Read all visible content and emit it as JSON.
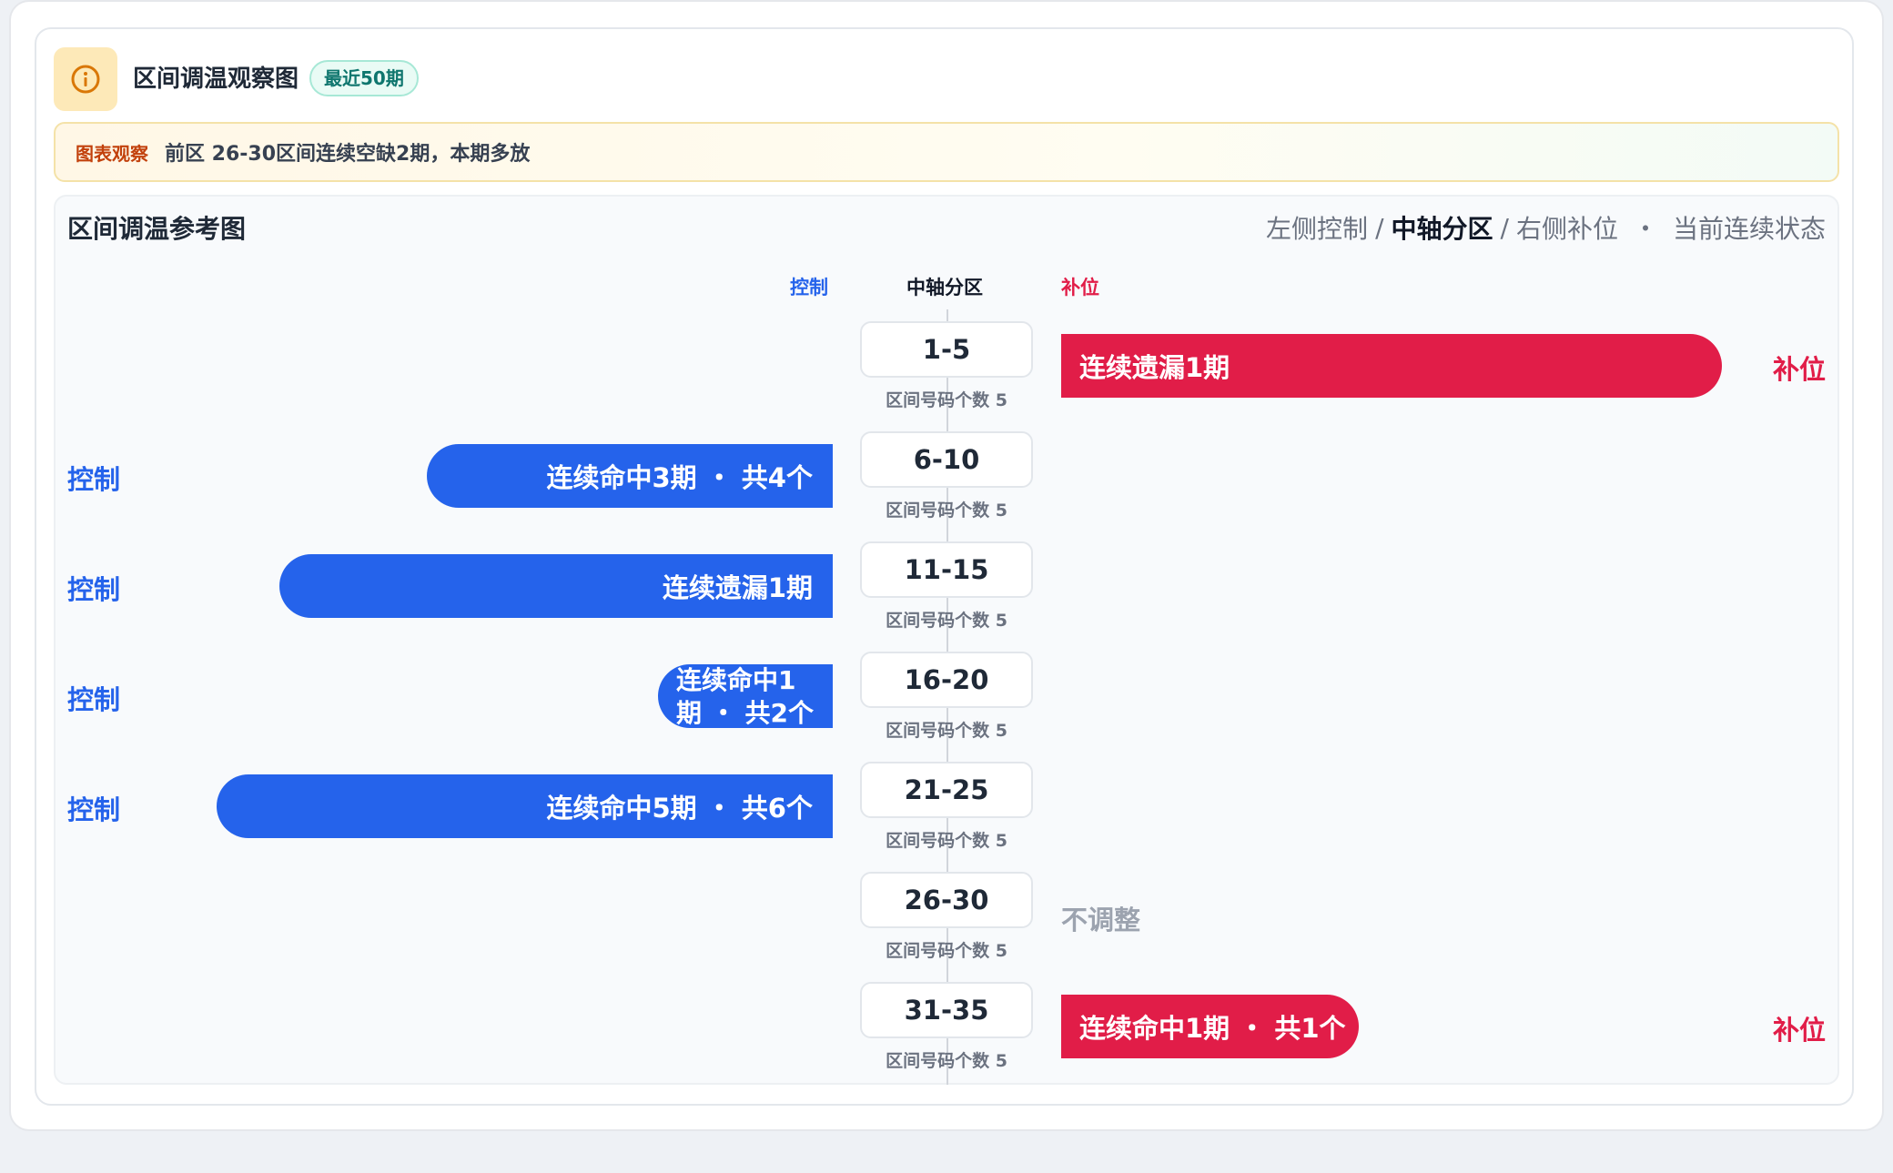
{
  "header": {
    "title": "区间调温观察图",
    "badge": "最近50期",
    "info_icon": "info-circle-icon"
  },
  "notice": {
    "label": "图表观察",
    "text": "前区 26-30区间连续空缺2期，本期多放"
  },
  "panel": {
    "title": "区间调温参考图",
    "legend": {
      "left": "左侧控制",
      "sep1": "/",
      "mid": "中轴分区",
      "sep2": "/",
      "right": "右侧补位",
      "dot": "・",
      "state": "当前连续状态"
    },
    "columns": {
      "left": "控制",
      "mid": "中轴分区",
      "right": "补位"
    }
  },
  "colors": {
    "control": "#2563eb",
    "fill": "#e11d48",
    "neutral": "#9ca3af"
  },
  "rows": [
    {
      "range": "1-5",
      "sub": "区间号码个数 5",
      "side": "right",
      "bar_text": "连续遗漏1期",
      "side_label": "补位",
      "level": 0.91
    },
    {
      "range": "6-10",
      "sub": "区间号码个数 5",
      "side": "left",
      "bar_text": "连续命中3期 ・ 共4个",
      "side_label": "控制",
      "level": 0.58
    },
    {
      "range": "11-15",
      "sub": "区间号码个数 5",
      "side": "left",
      "bar_text": "连续遗漏1期",
      "side_label": "控制",
      "level": 0.79
    },
    {
      "range": "16-20",
      "sub": "区间号码个数 5",
      "side": "left",
      "bar_text": "连续命中1期 ・ 共2个",
      "side_label": "控制",
      "level": 0.25
    },
    {
      "range": "21-25",
      "sub": "区间号码个数 5",
      "side": "left",
      "bar_text": "连续命中5期 ・ 共6个",
      "side_label": "控制",
      "level": 0.88
    },
    {
      "range": "26-30",
      "sub": "区间号码个数 5",
      "side": "none",
      "bar_text": "不调整",
      "side_label": ""
    },
    {
      "range": "31-35",
      "sub": "区间号码个数 5",
      "side": "right",
      "bar_text": "连续命中1期 ・ 共1个",
      "side_label": "补位",
      "level": 0.41
    }
  ]
}
